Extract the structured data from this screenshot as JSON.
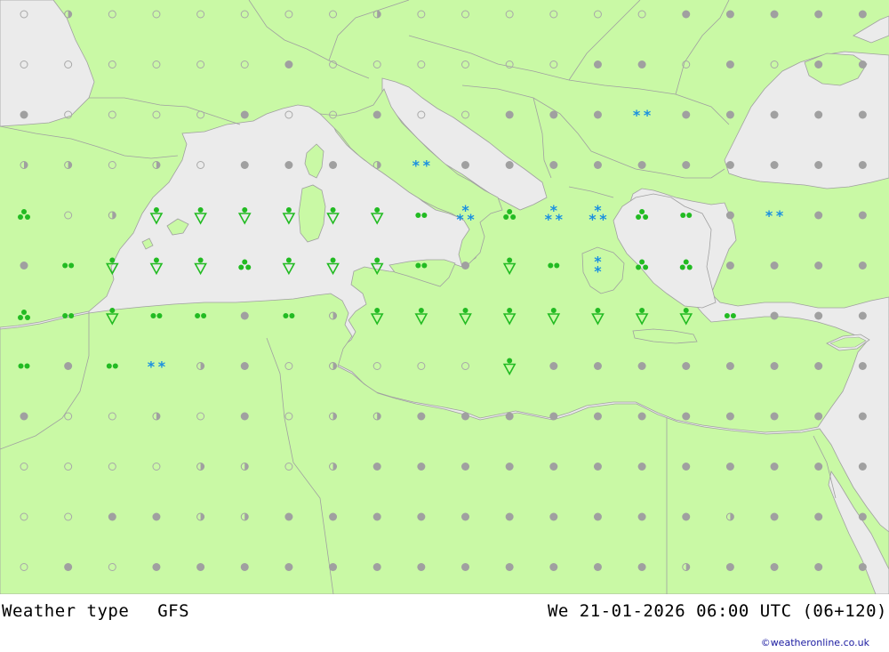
{
  "map": {
    "title": "Weather type",
    "model": "GFS",
    "valid_time": "We 21-01-2026 06:00 UTC (06+120)",
    "copyright": "©weatheronline.co.uk",
    "colors": {
      "land": "#c9f9a5",
      "sea": "#ebebeb",
      "border": "#a0a0a0",
      "overcast": "#a0a0a0",
      "rain": "#22bb22",
      "snow": "#1a8fe0"
    },
    "symbol_legend": {
      "clear": "open-circle-icon",
      "partly_cloudy": "half-circle-icon",
      "overcast": "filled-grey-circle-icon",
      "rain": "green-dots-icon",
      "showers": "green-shower-icon",
      "snow": "blue-snow-icon"
    },
    "grid_rows": [
      [
        "o",
        "h",
        "o",
        "o",
        "o",
        "o",
        "o",
        "o",
        "h",
        "o",
        "o",
        "o",
        "o",
        "o",
        "o",
        "g",
        "g",
        "g",
        "g",
        "g",
        "o"
      ],
      [
        "o",
        "o",
        "o",
        "o",
        "o",
        "o",
        "g",
        "o",
        "o",
        "o",
        "o",
        "o",
        "o",
        "g",
        "g",
        "o",
        "g",
        "o",
        "g",
        "g",
        "o"
      ],
      [
        "g",
        "o",
        "o",
        "o",
        "o",
        "g",
        "o",
        "o",
        "g",
        "o",
        "o",
        "g",
        "g",
        "g",
        "S2",
        "g",
        "g",
        "g",
        "g",
        "g",
        "g"
      ],
      [
        "h",
        "h",
        "o",
        "h",
        "o",
        "g",
        "g",
        "g",
        "h",
        "S2",
        "g",
        "g",
        "g",
        "g",
        "g",
        "g",
        "g",
        "g",
        "g",
        "g",
        "g"
      ],
      [
        "R3",
        "o",
        "h",
        "SH",
        "SH",
        "SH",
        "SH",
        "SH",
        "SH",
        "R2",
        "S3",
        "R3",
        "S3",
        "S3",
        "R3",
        "R2",
        "g",
        "S2",
        "g",
        "g",
        "g"
      ],
      [
        "g",
        "R2",
        "SH",
        "SH",
        "SH",
        "R3",
        "SH",
        "SH",
        "SH",
        "R2",
        "g",
        "SH",
        "R2",
        "SN",
        "R3",
        "R3",
        "g",
        "g",
        "g",
        "g",
        "S2"
      ],
      [
        "R3",
        "R2",
        "SH",
        "R2",
        "R2",
        "g",
        "R2",
        "h",
        "SH",
        "SH",
        "SH",
        "SH",
        "SH",
        "SH",
        "SH",
        "SH",
        "R2",
        "g",
        "g",
        "g",
        "g"
      ],
      [
        "R2",
        "g",
        "R2",
        "S2",
        "h",
        "g",
        "o",
        "h",
        "o",
        "o",
        "o",
        "SH",
        "g",
        "g",
        "g",
        "g",
        "g",
        "g",
        "g",
        "g",
        "g"
      ],
      [
        "g",
        "o",
        "o",
        "h",
        "o",
        "g",
        "o",
        "h",
        "h",
        "g",
        "g",
        "g",
        "g",
        "g",
        "g",
        "g",
        "g",
        "g",
        "g",
        "g",
        "g"
      ],
      [
        "o",
        "o",
        "o",
        "o",
        "h",
        "h",
        "o",
        "h",
        "g",
        "g",
        "g",
        "g",
        "g",
        "g",
        "g",
        "g",
        "g",
        "g",
        "g",
        "g",
        "g"
      ],
      [
        "o",
        "o",
        "g",
        "g",
        "h",
        "h",
        "g",
        "g",
        "g",
        "g",
        "g",
        "g",
        "g",
        "g",
        "g",
        "g",
        "h",
        "g",
        "g",
        "g",
        "g"
      ],
      [
        "o",
        "g",
        "o",
        "g",
        "g",
        "g",
        "g",
        "g",
        "g",
        "g",
        "g",
        "g",
        "g",
        "g",
        "g",
        "h",
        "g",
        "g",
        "g",
        "g",
        "g"
      ]
    ]
  }
}
